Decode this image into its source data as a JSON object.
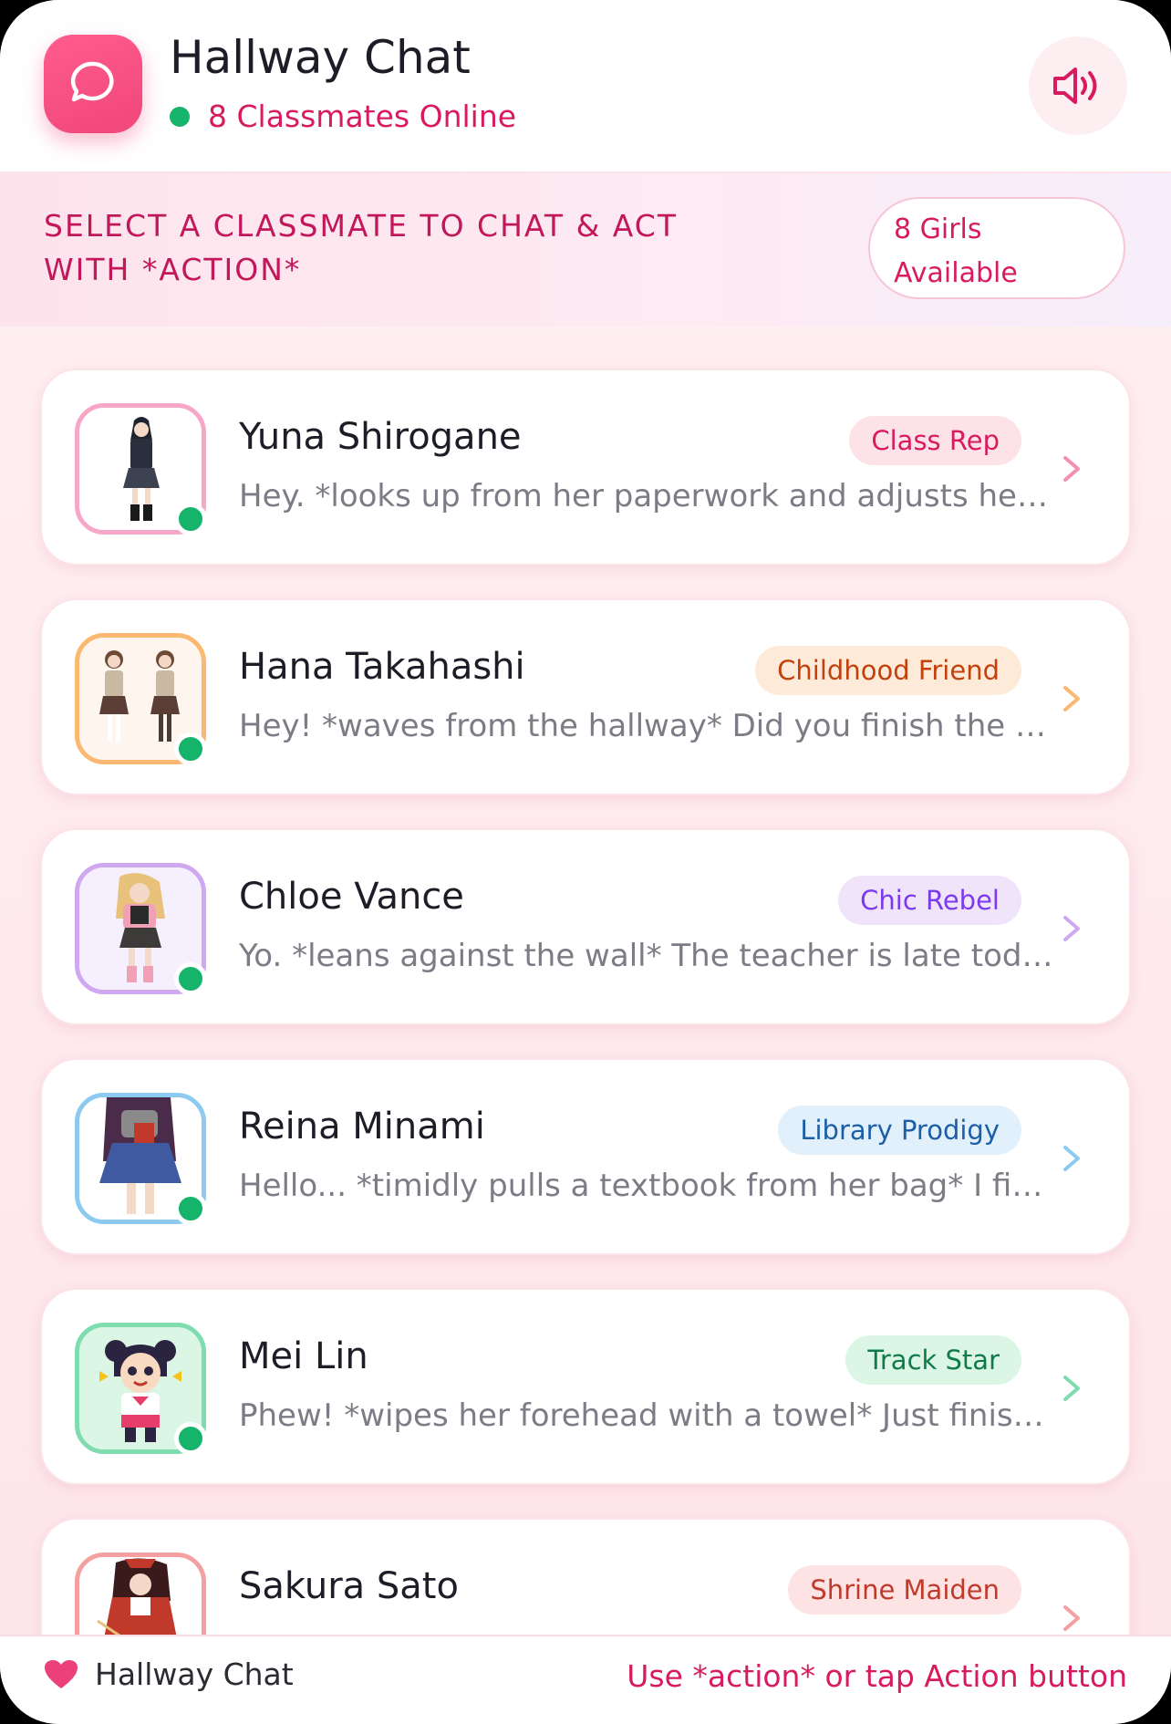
{
  "header": {
    "title": "Hallway Chat",
    "online_status": "8 Classmates Online",
    "icon": "chat-bubble-icon",
    "sound_icon": "speaker-icon"
  },
  "banner": {
    "instruction": "SELECT A CLASSMATE TO CHAT & ACT WITH *ACTION*",
    "count_badge": "8 Girls Available"
  },
  "classmates": [
    {
      "name": "Yuna Shirogane",
      "tag": "Class Rep",
      "preview": "Hey. *looks up from her paperwork and adjusts her glasses* Did you need something?",
      "online": true
    },
    {
      "name": "Hana Takahashi",
      "tag": "Childhood Friend",
      "preview": "Hey! *waves from the hallway* Did you finish the art homework?",
      "online": true
    },
    {
      "name": "Chloe Vance",
      "tag": "Chic Rebel",
      "preview": "Yo. *leans against the wall* The teacher is late today again.",
      "online": true
    },
    {
      "name": "Reina Minami",
      "tag": "Library Prodigy",
      "preview": "Hello... *timidly pulls a textbook from her bag* I finished the reading.",
      "online": true
    },
    {
      "name": "Mei Lin",
      "tag": "Track Star",
      "preview": "Phew! *wipes her forehead with a towel* Just finished my laps!",
      "online": true
    },
    {
      "name": "Sakura Sato",
      "tag": "Shrine Maiden",
      "preview": "",
      "online": true
    }
  ],
  "footer": {
    "label": "Hallway Chat",
    "hint": "Use *action* or tap Action button"
  },
  "colors": {
    "accent": "#d81b60",
    "online": "#16b36b",
    "tag_pink": "#fde3e8",
    "tag_orange": "#feead8",
    "tag_purple": "#f0e4fb",
    "tag_blue": "#e1f0fb",
    "tag_green": "#dcf6e6",
    "tag_red": "#fde3e3"
  }
}
